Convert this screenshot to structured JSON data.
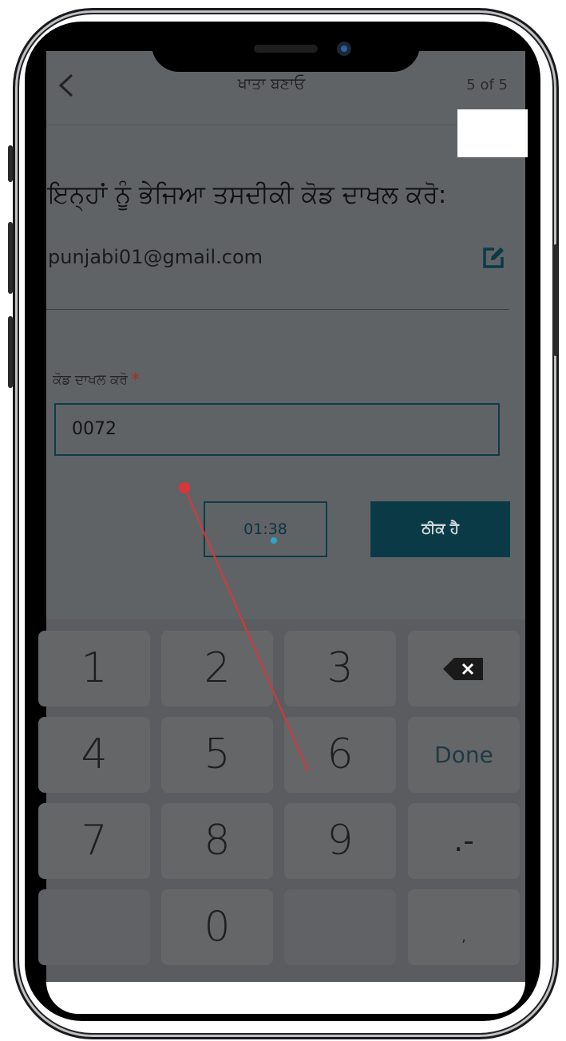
{
  "header": {
    "title": "ਖਾਤਾ ਬਣਾਓ",
    "step": "5 of 5"
  },
  "form": {
    "prompt": "ਇਨ੍ਹਾਂ ਨੂੰ ਭੇਜਿਆ ਤਸਦੀਕੀ ਕੋਡ ਦਾਖਲ ਕਰੋ:",
    "email": "punjabi01@gmail.com",
    "code_label": "ਕੋਡ ਦਾਖਲ ਕਰੋ",
    "required_mark": "*",
    "code_value": "0072"
  },
  "buttons": {
    "timer": "01:38",
    "ok": "ਠੀਕ ਹੈ"
  },
  "keyboard": {
    "keys": [
      "1",
      "2",
      "3",
      "4",
      "5",
      "6",
      "7",
      "8",
      "9",
      "0"
    ],
    "done": "Done",
    "dash": ".-",
    "comma": ","
  },
  "colors": {
    "accent": "#0b3a47",
    "required": "#a0302e",
    "annotation": "#d8363b"
  },
  "icons": {
    "back": "chevron-left-icon",
    "edit": "edit-icon",
    "backspace": "backspace-icon"
  }
}
